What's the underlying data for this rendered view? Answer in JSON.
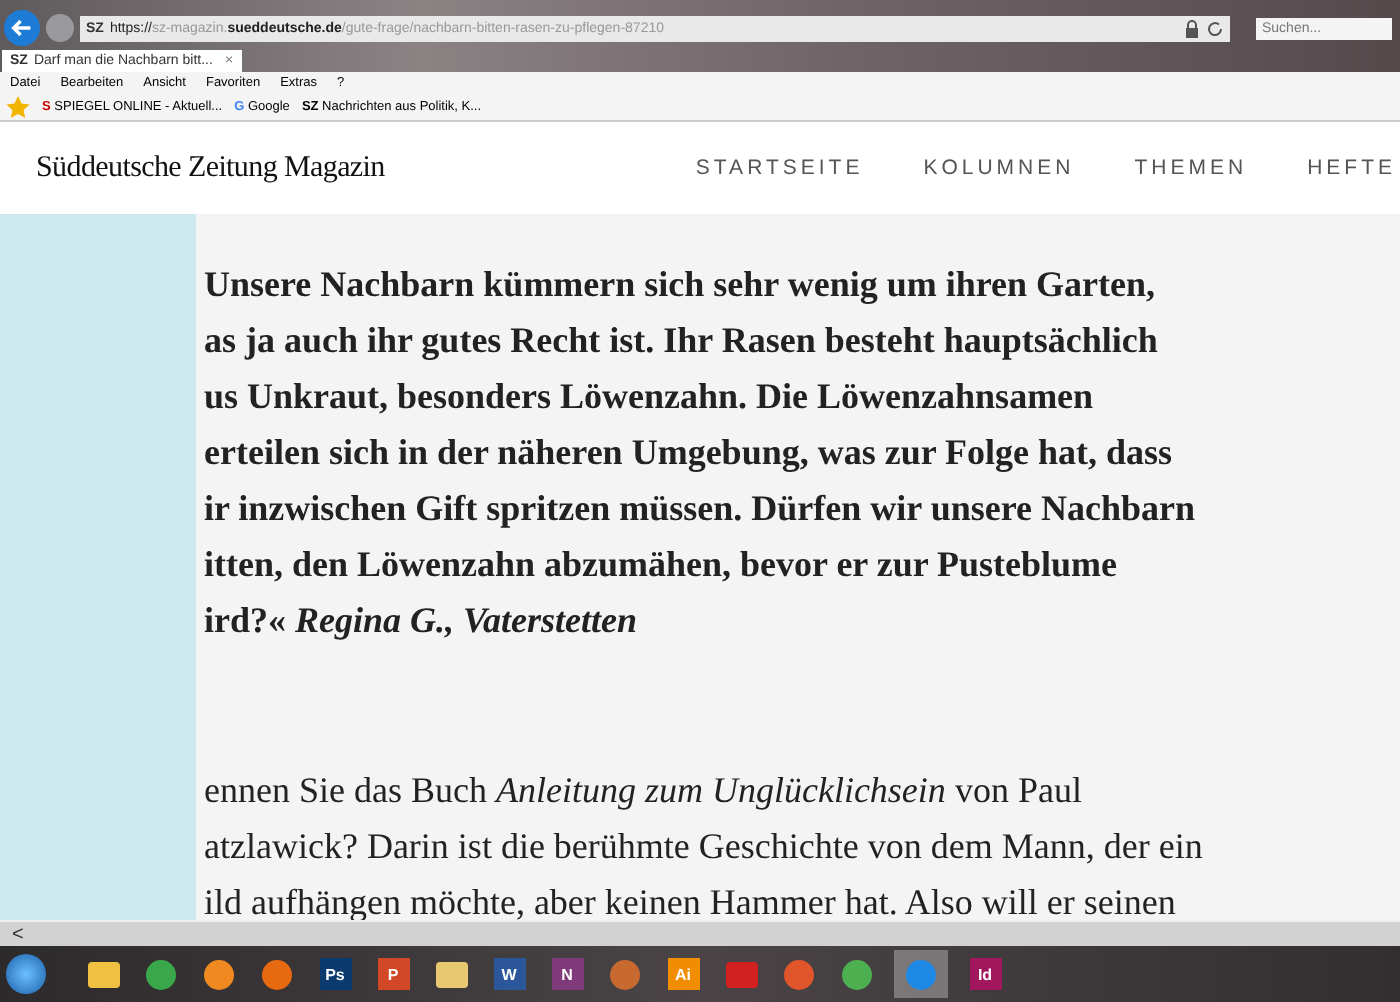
{
  "browser": {
    "address": {
      "favicon": "SZ",
      "scheme": "https://",
      "domain_prefix": "sz-magazin.",
      "domain": "sueddeutsche.de",
      "path": "/gute-frage/nachbarn-bitten-rasen-zu-pflegen-87210"
    },
    "search": {
      "placeholder": "Suchen..."
    },
    "tabs": [
      {
        "favicon": "SZ",
        "label": "Darf man die Nachbarn bitt...",
        "close": "×",
        "selected": true
      }
    ],
    "menu": [
      "Datei",
      "Bearbeiten",
      "Ansicht",
      "Favoriten",
      "Extras",
      "?"
    ],
    "favorites": [
      {
        "kind": "spiegel",
        "icon_text": "S",
        "label": "SPIEGEL ONLINE - Aktuell..."
      },
      {
        "kind": "google",
        "icon_text": "G",
        "label": "Google"
      },
      {
        "kind": "sz",
        "icon_text": "SZ",
        "label": "Nachrichten aus Politik, K..."
      }
    ]
  },
  "site": {
    "logo": "Süddeutsche Zeitung Magazin",
    "nav": [
      "STARTSEITE",
      "KOLUMNEN",
      "THEMEN",
      "HEFTE"
    ]
  },
  "article": {
    "paragraphs": [
      {
        "kind": "question",
        "lines": [
          "Unsere Nachbarn kümmern sich sehr wenig um ihren Garten,",
          "as ja auch ihr gutes Recht ist. Ihr Rasen besteht hauptsächlich",
          "us Unkraut, besonders Löwenzahn. Die Löwenzahnsamen",
          "erteilen sich in der näheren Umgebung, was zur Folge hat, dass",
          "ir inzwischen Gift spritzen müssen. Dürfen wir unsere Nachbarn",
          "itten, den Löwenzahn abzumähen, bevor er zur Pusteblume",
          "ird?« *Regina G., Vaterstetten*"
        ]
      },
      {
        "kind": "answer",
        "lines": [
          "ennen Sie das Buch *Anleitung zum Unglücklichsein* von Paul",
          "atzlawick? Darin ist die berühmte Geschichte von dem Mann, der ein",
          "ild aufhängen möchte, aber keinen Hammer hat. Also will er seinen"
        ]
      }
    ]
  },
  "scrollbar": {
    "arrow": "<"
  },
  "taskbar": {
    "apps": [
      {
        "kind": "glyph",
        "color": "#f0c040",
        "selected": false
      },
      {
        "kind": "orb",
        "color": "#3aa84a",
        "selected": false
      },
      {
        "kind": "orb",
        "color": "#f08a20",
        "selected": false
      },
      {
        "kind": "orb",
        "color": "#e86a10",
        "selected": false
      },
      {
        "kind": "letter",
        "label": "Ps",
        "color": "#0b3b6e",
        "selected": false
      },
      {
        "kind": "letter",
        "label": "P",
        "color": "#d24726",
        "selected": false
      },
      {
        "kind": "glyph",
        "color": "#e8c870",
        "selected": false
      },
      {
        "kind": "letter",
        "label": "W",
        "color": "#2b579a",
        "selected": false
      },
      {
        "kind": "letter",
        "label": "N",
        "color": "#80397b",
        "selected": false
      },
      {
        "kind": "orb",
        "color": "#c86a30",
        "selected": false
      },
      {
        "kind": "letter",
        "label": "Ai",
        "color": "#f28c00",
        "selected": false
      },
      {
        "kind": "glyph",
        "color": "#d32020",
        "selected": false
      },
      {
        "kind": "orb",
        "color": "#e0552a",
        "selected": false
      },
      {
        "kind": "orb",
        "color": "#4caf50",
        "selected": false
      },
      {
        "kind": "orb",
        "color": "#1e88e5",
        "selected": true
      },
      {
        "kind": "letter",
        "label": "Id",
        "color": "#a0175d",
        "selected": false
      }
    ]
  }
}
